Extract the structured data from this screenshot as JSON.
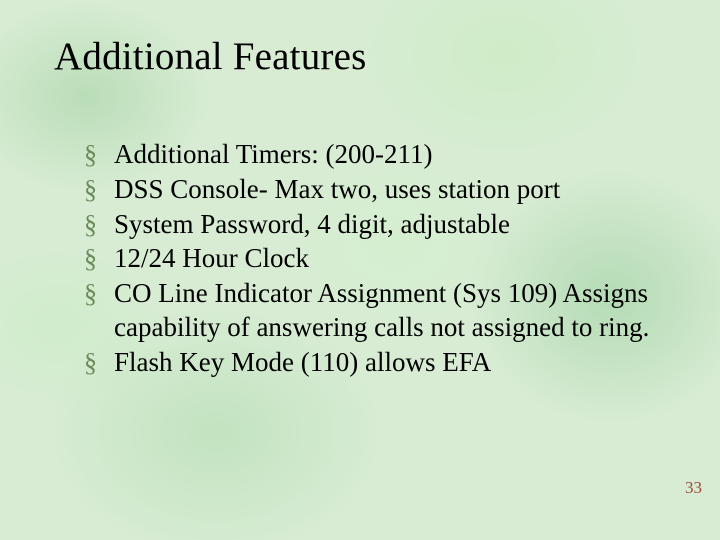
{
  "slide": {
    "title": "Additional Features",
    "bullet_glyph": "§",
    "items": [
      "Additional Timers: (200-211)",
      "DSS Console- Max two, uses station port",
      "System Password, 4 digit, adjustable",
      "12/24 Hour Clock",
      "CO Line Indicator Assignment (Sys 109) Assigns capability of answering calls not assigned to ring.",
      "Flash Key Mode (110) allows EFA"
    ],
    "page_number": "33"
  }
}
